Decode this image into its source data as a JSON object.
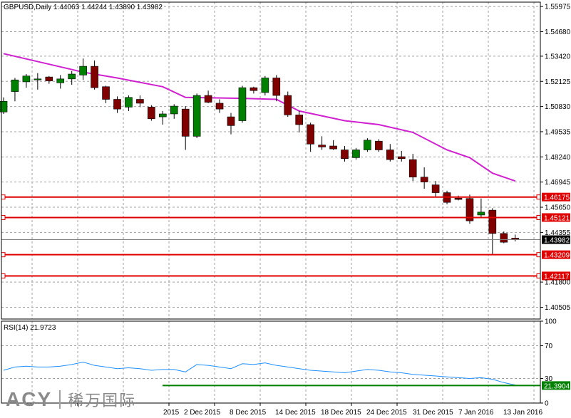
{
  "header": {
    "symbol_line": "GBPUSD,Daily  1.44063 1.44244 1.43890 1.43982"
  },
  "rsi_header": "RSI(14) 21.9723",
  "logo": {
    "brand": "ACY",
    "chinese": "稀万国际"
  },
  "colors": {
    "bull": "#008000",
    "bear": "#800000",
    "ma": "#d020d0",
    "rsi": "#1e90ff",
    "levels": "#e00000",
    "rsi_level": "#008000",
    "grid": "#a0a0a0"
  },
  "chart_data": [
    {
      "type": "candlestick",
      "symbol": "GBPUSD",
      "timeframe": "Daily",
      "ylim": [
        1.399,
        1.562
      ],
      "y_ticks": [
        "1.55975",
        "1.54680",
        "1.53420",
        "1.52125",
        "1.50830",
        "1.49535",
        "1.48240",
        "1.46945",
        "1.45650",
        "1.44355",
        "1.41800",
        "1.40505"
      ],
      "x_tick_labels": [
        "2015",
        "2 Dec 2015",
        "8 Dec 2015",
        "14 Dec 2015",
        "18 Dec 2015",
        "24 Dec 2015",
        "31 Dec 2015",
        "7 Jan 2016",
        "13 Jan 2016"
      ],
      "candles": [
        {
          "o": 1.5055,
          "h": 1.513,
          "l": 1.5045,
          "c": 1.511
        },
        {
          "o": 1.516,
          "h": 1.523,
          "l": 1.511,
          "c": 1.522
        },
        {
          "o": 1.521,
          "h": 1.525,
          "l": 1.518,
          "c": 1.524
        },
        {
          "o": 1.522,
          "h": 1.5255,
          "l": 1.517,
          "c": 1.5225
        },
        {
          "o": 1.5235,
          "h": 1.524,
          "l": 1.52,
          "c": 1.5215
        },
        {
          "o": 1.5205,
          "h": 1.5245,
          "l": 1.5175,
          "c": 1.5225
        },
        {
          "o": 1.5225,
          "h": 1.5265,
          "l": 1.5195,
          "c": 1.525
        },
        {
          "o": 1.5245,
          "h": 1.533,
          "l": 1.522,
          "c": 1.529
        },
        {
          "o": 1.529,
          "h": 1.532,
          "l": 1.517,
          "c": 1.518
        },
        {
          "o": 1.5185,
          "h": 1.519,
          "l": 1.51,
          "c": 1.512
        },
        {
          "o": 1.512,
          "h": 1.5135,
          "l": 1.505,
          "c": 1.507
        },
        {
          "o": 1.508,
          "h": 1.514,
          "l": 1.506,
          "c": 1.513
        },
        {
          "o": 1.512,
          "h": 1.514,
          "l": 1.508,
          "c": 1.51
        },
        {
          "o": 1.508,
          "h": 1.509,
          "l": 1.501,
          "c": 1.502
        },
        {
          "o": 1.503,
          "h": 1.506,
          "l": 1.499,
          "c": 1.5045
        },
        {
          "o": 1.5045,
          "h": 1.5095,
          "l": 1.502,
          "c": 1.5085
        },
        {
          "o": 1.507,
          "h": 1.5085,
          "l": 1.486,
          "c": 1.493
        },
        {
          "o": 1.493,
          "h": 1.515,
          "l": 1.492,
          "c": 1.514
        },
        {
          "o": 1.514,
          "h": 1.5165,
          "l": 1.51,
          "c": 1.5105
        },
        {
          "o": 1.51,
          "h": 1.512,
          "l": 1.505,
          "c": 1.507
        },
        {
          "o": 1.503,
          "h": 1.505,
          "l": 1.494,
          "c": 1.4985
        },
        {
          "o": 1.501,
          "h": 1.519,
          "l": 1.5,
          "c": 1.518
        },
        {
          "o": 1.518,
          "h": 1.5185,
          "l": 1.515,
          "c": 1.5165
        },
        {
          "o": 1.5155,
          "h": 1.524,
          "l": 1.514,
          "c": 1.523
        },
        {
          "o": 1.523,
          "h": 1.5245,
          "l": 1.511,
          "c": 1.514
        },
        {
          "o": 1.514,
          "h": 1.516,
          "l": 1.503,
          "c": 1.504
        },
        {
          "o": 1.504,
          "h": 1.506,
          "l": 1.495,
          "c": 1.499
        },
        {
          "o": 1.499,
          "h": 1.5,
          "l": 1.485,
          "c": 1.489
        },
        {
          "o": 1.4885,
          "h": 1.493,
          "l": 1.486,
          "c": 1.4875
        },
        {
          "o": 1.488,
          "h": 1.491,
          "l": 1.486,
          "c": 1.4865
        },
        {
          "o": 1.486,
          "h": 1.488,
          "l": 1.48,
          "c": 1.4815
        },
        {
          "o": 1.482,
          "h": 1.487,
          "l": 1.481,
          "c": 1.486
        },
        {
          "o": 1.486,
          "h": 1.492,
          "l": 1.485,
          "c": 1.491
        },
        {
          "o": 1.4905,
          "h": 1.4915,
          "l": 1.485,
          "c": 1.486
        },
        {
          "o": 1.486,
          "h": 1.489,
          "l": 1.48,
          "c": 1.481
        },
        {
          "o": 1.4825,
          "h": 1.4855,
          "l": 1.48,
          "c": 1.4815
        },
        {
          "o": 1.481,
          "h": 1.484,
          "l": 1.47,
          "c": 1.472
        },
        {
          "o": 1.472,
          "h": 1.477,
          "l": 1.466,
          "c": 1.4695
        },
        {
          "o": 1.468,
          "h": 1.47,
          "l": 1.462,
          "c": 1.464
        },
        {
          "o": 1.464,
          "h": 1.465,
          "l": 1.458,
          "c": 1.459
        },
        {
          "o": 1.4612,
          "h": 1.4625,
          "l": 1.46,
          "c": 1.4605
        },
        {
          "o": 1.461,
          "h": 1.463,
          "l": 1.448,
          "c": 1.4495
        },
        {
          "o": 1.4525,
          "h": 1.461,
          "l": 1.451,
          "c": 1.454
        },
        {
          "o": 1.455,
          "h": 1.456,
          "l": 1.432,
          "c": 1.443
        },
        {
          "o": 1.443,
          "h": 1.444,
          "l": 1.438,
          "c": 1.4385
        },
        {
          "o": 1.44063,
          "h": 1.44244,
          "l": 1.4389,
          "c": 1.43982
        }
      ],
      "moving_average": [
        {
          "i": 0,
          "v": 1.5355
        },
        {
          "i": 7,
          "v": 1.526
        },
        {
          "i": 10,
          "v": 1.523
        },
        {
          "i": 14,
          "v": 1.5185
        },
        {
          "i": 16,
          "v": 1.513
        },
        {
          "i": 21,
          "v": 1.5125
        },
        {
          "i": 24,
          "v": 1.512
        },
        {
          "i": 26,
          "v": 1.506
        },
        {
          "i": 30,
          "v": 1.501
        },
        {
          "i": 33,
          "v": 1.499
        },
        {
          "i": 36,
          "v": 1.495
        },
        {
          "i": 39,
          "v": 1.486
        },
        {
          "i": 41,
          "v": 1.482
        },
        {
          "i": 43,
          "v": 1.474
        },
        {
          "i": 45,
          "v": 1.47
        }
      ],
      "horizontal_levels": [
        {
          "value": 1.46175,
          "label": "1.46175"
        },
        {
          "value": 1.45121,
          "label": "1.45121"
        },
        {
          "value": 1.43209,
          "label": "1.43209"
        },
        {
          "value": 1.42117,
          "label": "1.42117"
        }
      ],
      "current_price": {
        "value": 1.43982,
        "label": "1.43982"
      }
    },
    {
      "type": "line",
      "name": "RSI(14)",
      "ylim": [
        0,
        100
      ],
      "y_ticks": [
        "100",
        "70",
        "30",
        "0"
      ],
      "level": {
        "value": 21.3904,
        "label": "21.3904"
      },
      "x": [
        0,
        1,
        2,
        3,
        4,
        5,
        6,
        7,
        8,
        9,
        10,
        11,
        12,
        13,
        14,
        15,
        16,
        17,
        18,
        19,
        20,
        21,
        22,
        23,
        24,
        25,
        26,
        27,
        28,
        29,
        30,
        31,
        32,
        33,
        34,
        35,
        36,
        37,
        38,
        39,
        40,
        41,
        42,
        43,
        44,
        45
      ],
      "values": [
        40,
        44,
        45,
        44,
        44,
        45,
        47,
        50,
        46,
        44,
        42,
        43,
        42,
        40,
        41,
        41,
        38,
        47,
        46,
        44,
        42,
        48,
        47,
        49,
        46,
        44,
        42,
        40,
        39,
        38,
        37,
        39,
        41,
        40,
        38,
        37,
        35,
        34,
        33,
        32,
        31,
        30,
        31,
        29,
        25,
        21.97
      ]
    }
  ]
}
